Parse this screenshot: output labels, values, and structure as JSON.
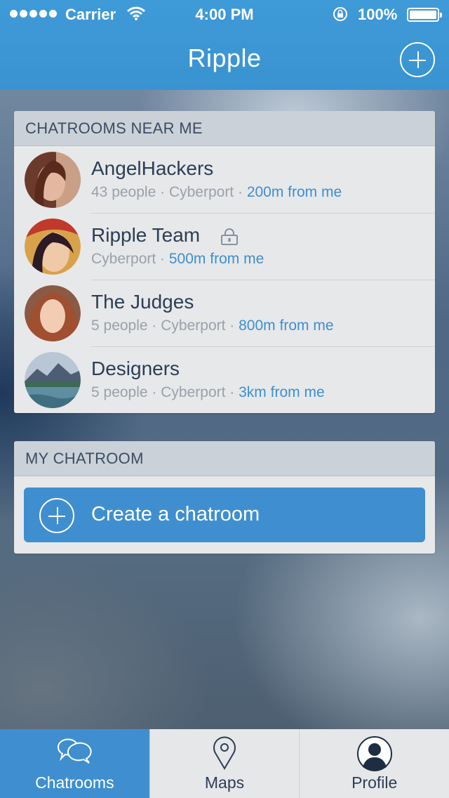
{
  "status_bar": {
    "carrier": "Carrier",
    "time": "4:00 PM",
    "battery": "100%",
    "icons": [
      "signal-dots-icon",
      "wifi-icon",
      "rotation-lock-icon",
      "battery-icon"
    ]
  },
  "nav": {
    "title": "Ripple",
    "add_icon": "plus-circle-icon"
  },
  "nearby": {
    "header": "CHATROOMS NEAR ME",
    "rooms": [
      {
        "name": "AngelHackers",
        "people": "43 people",
        "place": "Cyberport",
        "distance": "200m from me",
        "locked": false
      },
      {
        "name": "Ripple Team",
        "people": "",
        "place": "Cyberport",
        "distance": "500m from me",
        "locked": true
      },
      {
        "name": "The Judges",
        "people": "5 people",
        "place": "Cyberport",
        "distance": "800m from me",
        "locked": false
      },
      {
        "name": "Designers",
        "people": "5 people",
        "place": "Cyberport",
        "distance": "3km from me",
        "locked": false
      }
    ]
  },
  "mine": {
    "header": "MY CHATROOM",
    "create_label": "Create a chatroom"
  },
  "tabs": [
    {
      "label": "Chatrooms",
      "icon": "chat-bubbles-icon",
      "active": true
    },
    {
      "label": "Maps",
      "icon": "map-pin-icon",
      "active": false
    },
    {
      "label": "Profile",
      "icon": "person-icon",
      "active": false
    }
  ],
  "colors": {
    "accent": "#3f8fd0",
    "nav_bar": "#3a93d1",
    "distance_text": "#3e8fcf"
  }
}
